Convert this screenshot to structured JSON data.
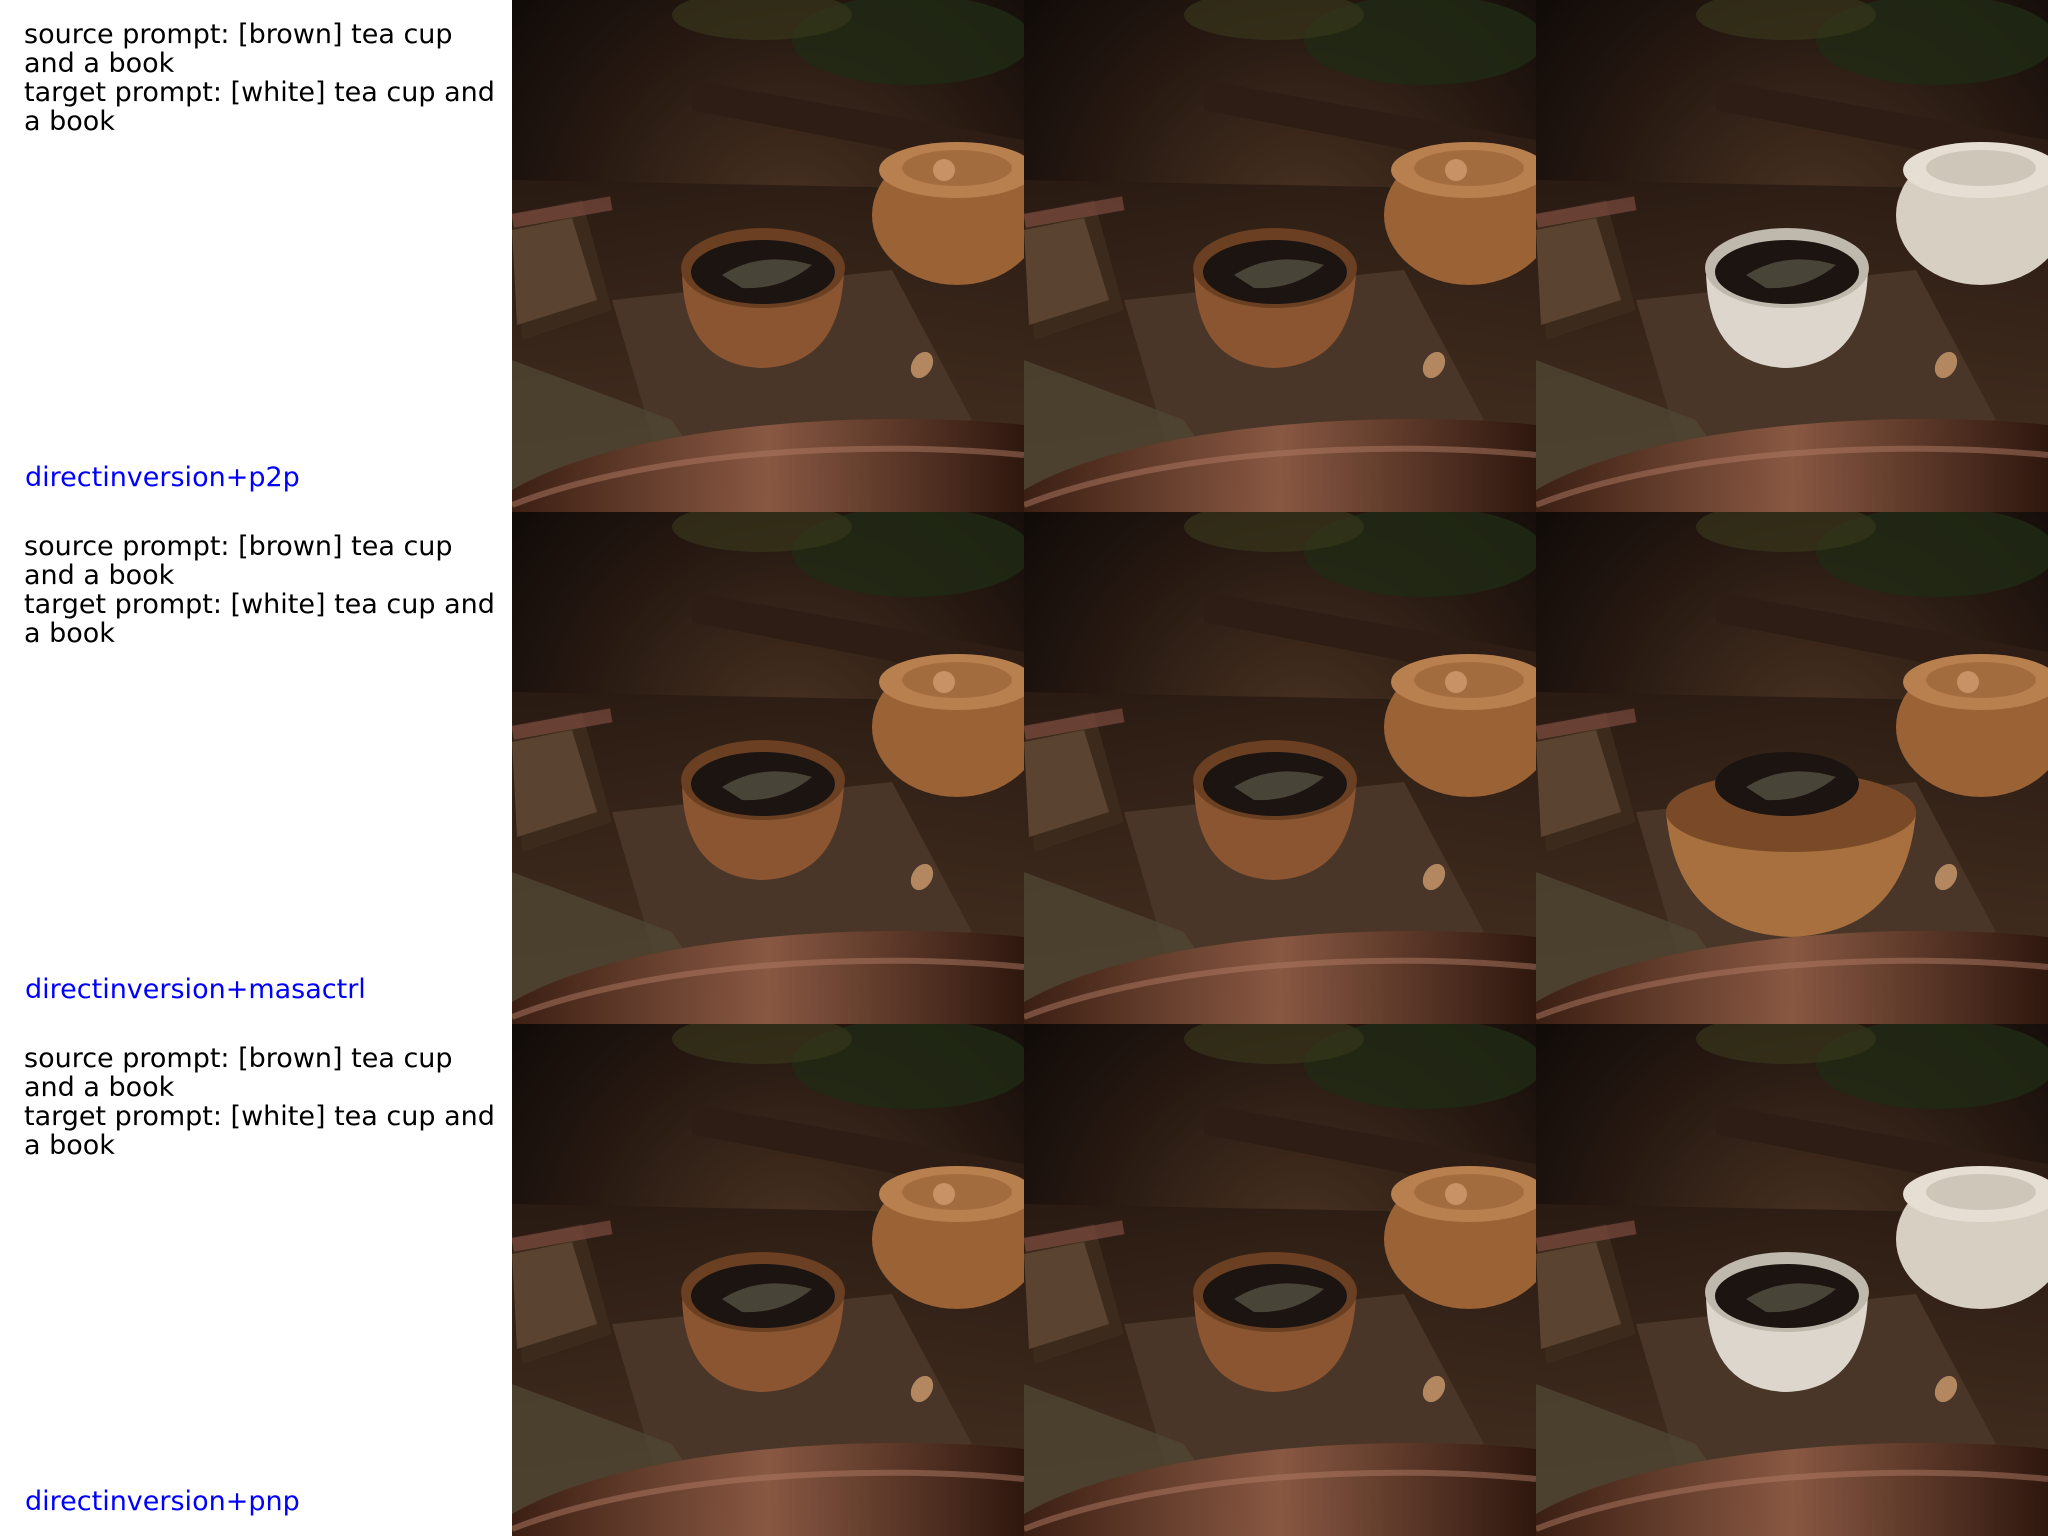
{
  "colors": {
    "method_label": "#0000ff",
    "prompt_text": "#000000",
    "background": "#ffffff",
    "cup_brown": "#8a5530",
    "cup_white": "#dcd6cc",
    "cup_variant": "#a8703f"
  },
  "rows": [
    {
      "source_prompt": "source prompt: [brown] tea cup and a book",
      "target_prompt": "target prompt: [white] tea cup and a book",
      "method": "directinversion+p2p",
      "panels": [
        {
          "variant": "source",
          "cup_color": "brown"
        },
        {
          "variant": "reconstruction",
          "cup_color": "brown"
        },
        {
          "variant": "edited",
          "cup_color": "white"
        }
      ]
    },
    {
      "source_prompt": "source prompt: [brown] tea cup and a book",
      "target_prompt": "target prompt: [white] tea cup and a book",
      "method": "directinversion+masactrl",
      "panels": [
        {
          "variant": "source",
          "cup_color": "brown"
        },
        {
          "variant": "reconstruction",
          "cup_color": "brown"
        },
        {
          "variant": "edited",
          "cup_color": "brown-wide"
        }
      ]
    },
    {
      "source_prompt": "source prompt: [brown] tea cup and a book",
      "target_prompt": "target prompt: [white] tea cup and a book",
      "method": "directinversion+pnp",
      "panels": [
        {
          "variant": "source",
          "cup_color": "brown"
        },
        {
          "variant": "reconstruction",
          "cup_color": "brown"
        },
        {
          "variant": "edited",
          "cup_color": "white"
        }
      ]
    }
  ]
}
